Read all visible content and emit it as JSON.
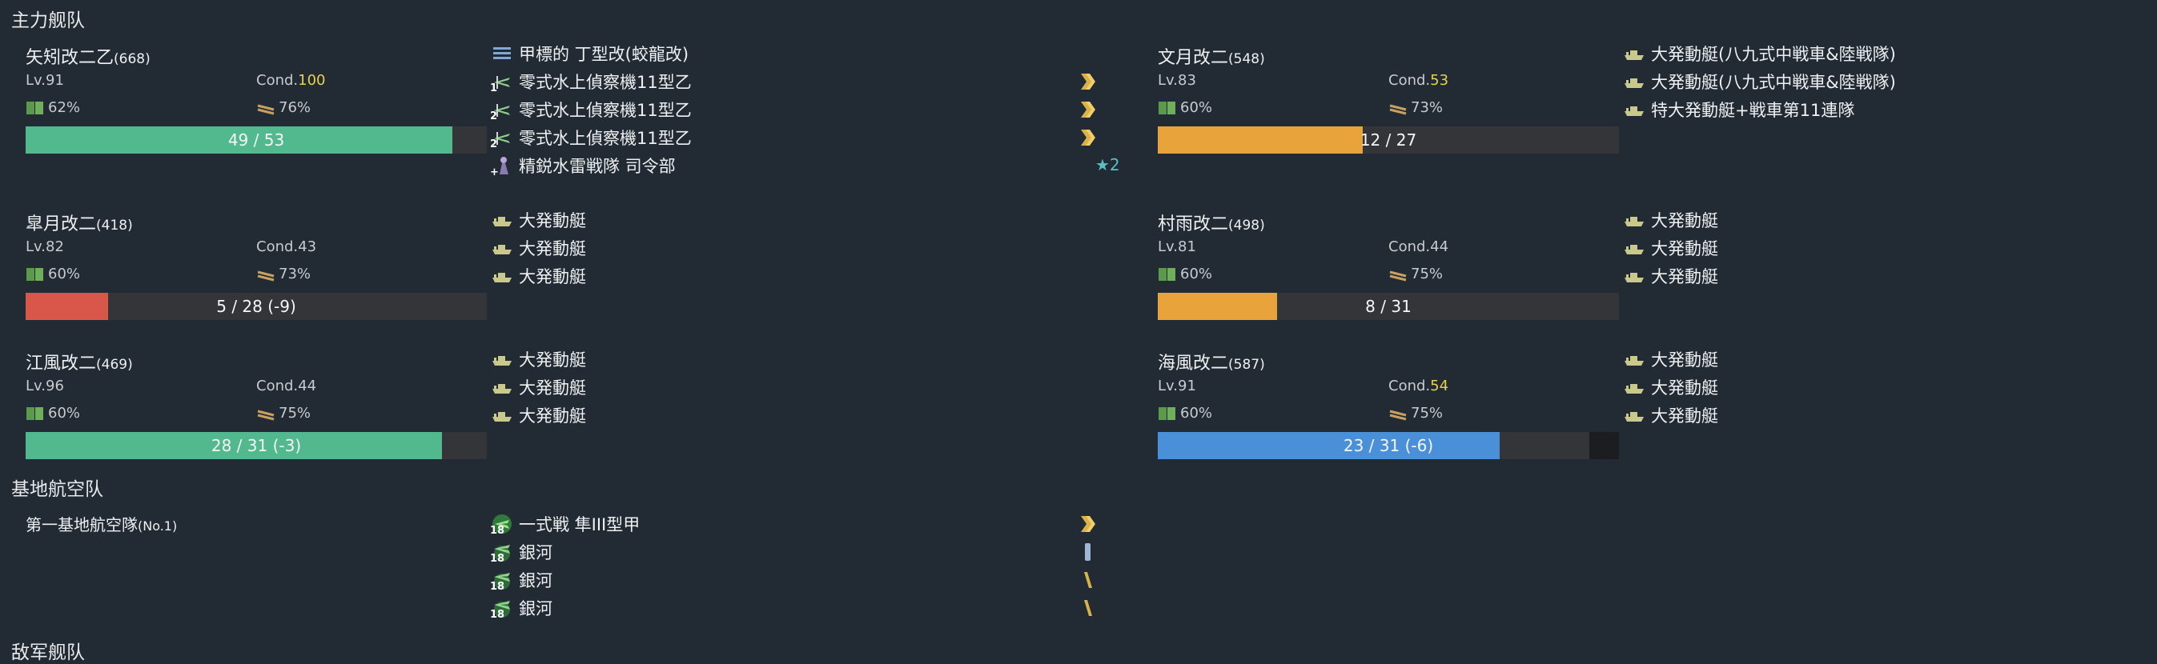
{
  "sections": {
    "main_fleet": "主力舰队",
    "land_base": "基地航空队",
    "enemy_fleet": "敌军舰队"
  },
  "colors": {
    "background": "#222a33",
    "hp_green": "#52b98f",
    "hp_orange": "#e8a33a",
    "hp_red": "#d9574a",
    "hp_blue": "#4a90d9",
    "cond_sparkle": "#e7d34a",
    "star": "#5bc0c6"
  },
  "ships": [
    {
      "name": "矢矧改二乙",
      "id": "(668)",
      "lv": "Lv.91",
      "cond_label": "Cond.",
      "cond": "100",
      "cond_high": true,
      "fuel": "62%",
      "ammo": "76%",
      "hp_text": "49 / 53",
      "hp_fraction": 0.9245,
      "hp_max_fraction": 1.0,
      "hp_color": "green",
      "equipment": [
        {
          "icon": "radar-icon",
          "label": "甲標的 丁型改(蛟龍改)",
          "prof": "",
          "num": ""
        },
        {
          "icon": "seaplane-icon",
          "label": "零式水上偵察機11型乙",
          "prof": "chevron-double",
          "num": "1"
        },
        {
          "icon": "seaplane-icon",
          "label": "零式水上偵察機11型乙",
          "prof": "chevron-double",
          "num": "2"
        },
        {
          "icon": "seaplane-icon",
          "label": "零式水上偵察機11型乙",
          "prof": "chevron-double",
          "num": "2"
        },
        {
          "icon": "crew-icon",
          "label": "精鋭水雷戦隊 司令部",
          "prof": "",
          "num": "+",
          "star": "★2"
        }
      ]
    },
    {
      "name": "文月改二",
      "id": "(548)",
      "lv": "Lv.83",
      "cond_label": "Cond.",
      "cond": "53",
      "cond_high": true,
      "fuel": "60%",
      "ammo": "73%",
      "hp_text": "12 / 27",
      "hp_fraction": 0.4444,
      "hp_max_fraction": 1.0,
      "hp_color": "orange",
      "equipment": [
        {
          "icon": "landing-craft-icon",
          "label": "大発動艇(八九式中戦車&陸戦隊)"
        },
        {
          "icon": "landing-craft-icon",
          "label": "大発動艇(八九式中戦車&陸戦隊)"
        },
        {
          "icon": "landing-craft-icon",
          "label": "特大発動艇+戦車第11連隊"
        }
      ]
    },
    {
      "name": "皐月改二",
      "id": "(418)",
      "lv": "Lv.82",
      "cond_label": "Cond.",
      "cond": "43",
      "cond_high": false,
      "fuel": "60%",
      "ammo": "73%",
      "hp_text": "5 / 28 (-9)",
      "hp_fraction": 0.1786,
      "hp_max_fraction": 1.0,
      "hp_color": "red",
      "equipment": [
        {
          "icon": "landing-craft-icon",
          "label": "大発動艇"
        },
        {
          "icon": "landing-craft-icon",
          "label": "大発動艇"
        },
        {
          "icon": "landing-craft-icon",
          "label": "大発動艇"
        }
      ]
    },
    {
      "name": "村雨改二",
      "id": "(498)",
      "lv": "Lv.81",
      "cond_label": "Cond.",
      "cond": "44",
      "cond_high": false,
      "fuel": "60%",
      "ammo": "75%",
      "hp_text": "8 / 31",
      "hp_fraction": 0.2581,
      "hp_max_fraction": 1.0,
      "hp_color": "orange",
      "equipment": [
        {
          "icon": "landing-craft-icon",
          "label": "大発動艇"
        },
        {
          "icon": "landing-craft-icon",
          "label": "大発動艇"
        },
        {
          "icon": "landing-craft-icon",
          "label": "大発動艇"
        }
      ]
    },
    {
      "name": "江風改二",
      "id": "(469)",
      "lv": "Lv.96",
      "cond_label": "Cond.",
      "cond": "44",
      "cond_high": false,
      "fuel": "60%",
      "ammo": "75%",
      "hp_text": "28 / 31 (-3)",
      "hp_fraction": 0.9032,
      "hp_max_fraction": 1.0,
      "hp_color": "green",
      "equipment": [
        {
          "icon": "landing-craft-icon",
          "label": "大発動艇"
        },
        {
          "icon": "landing-craft-icon",
          "label": "大発動艇"
        },
        {
          "icon": "landing-craft-icon",
          "label": "大発動艇"
        }
      ]
    },
    {
      "name": "海風改二",
      "id": "(587)",
      "lv": "Lv.91",
      "cond_label": "Cond.",
      "cond": "54",
      "cond_high": true,
      "fuel": "60%",
      "ammo": "75%",
      "hp_text": "23 / 31 (-6)",
      "hp_fraction": 0.7419,
      "hp_max_fraction": 0.9355,
      "hp_color": "blue",
      "equipment": [
        {
          "icon": "landing-craft-icon",
          "label": "大発動艇"
        },
        {
          "icon": "landing-craft-icon",
          "label": "大発動艇"
        },
        {
          "icon": "landing-craft-icon",
          "label": "大発動艇"
        }
      ]
    }
  ],
  "land_base": {
    "name": "第一基地航空隊",
    "id": "(No.1)",
    "squadrons": [
      {
        "icon": "fighter-icon",
        "count": "18",
        "label": "一式戦 隼III型甲",
        "prof": "chevron-double"
      },
      {
        "icon": "bomber-icon",
        "count": "18",
        "label": "銀河",
        "prof": "bar-blue"
      },
      {
        "icon": "bomber-icon",
        "count": "18",
        "label": "銀河",
        "prof": "slash"
      },
      {
        "icon": "bomber-icon",
        "count": "18",
        "label": "銀河",
        "prof": "slash"
      }
    ]
  }
}
